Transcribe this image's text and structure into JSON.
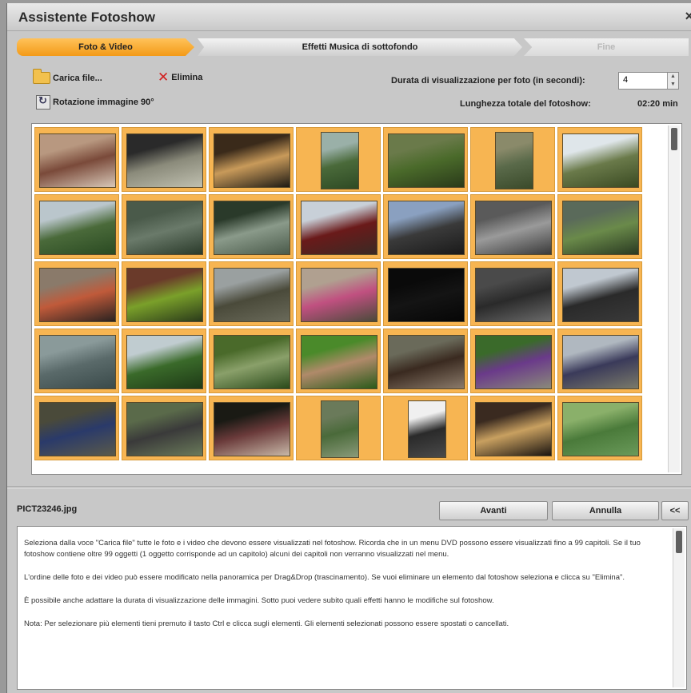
{
  "window": {
    "title": "Assistente Fotoshow",
    "close_glyph": "×"
  },
  "steps": [
    "Foto & Video",
    "Effetti  Musica di sottofondo",
    "Fine"
  ],
  "toolbar": {
    "load_label": "Carica file...",
    "delete_label": "Elimina",
    "rotate_label": "Rotazione immagine 90°",
    "duration_label": "Durata di visualizzazione per foto (in secondi):",
    "duration_value": "4",
    "total_label": "Lunghezza totale del fotoshow:",
    "total_value": "02:20 min"
  },
  "photos": [
    {
      "o": "land",
      "c": [
        "#b89880",
        "#7a4a3a",
        "#d8c8b8"
      ]
    },
    {
      "o": "land",
      "c": [
        "#2a2a2a",
        "#8a8a7a",
        "#c0c0b0"
      ]
    },
    {
      "o": "land",
      "c": [
        "#3a2a1a",
        "#c89a5a",
        "#1e1a14"
      ]
    },
    {
      "o": "port",
      "c": [
        "#9ab0a8",
        "#4a6a3a",
        "#2e4a24"
      ]
    },
    {
      "o": "land",
      "c": [
        "#6a7a4a",
        "#4a6a2a",
        "#2a3a1a"
      ]
    },
    {
      "o": "port",
      "c": [
        "#8a8a6a",
        "#5a6a4a",
        "#3a4a2a"
      ]
    },
    {
      "o": "land",
      "c": [
        "#dfe6ea",
        "#6a7a4a",
        "#3a4a22"
      ]
    },
    {
      "o": "land",
      "c": [
        "#bac6cc",
        "#4a6a3a",
        "#2a4a22"
      ]
    },
    {
      "o": "land",
      "c": [
        "#4a5a4a",
        "#6a7a6a",
        "#2a3a2a"
      ]
    },
    {
      "o": "land",
      "c": [
        "#2a3a2a",
        "#8a9a8a",
        "#4a5a4a"
      ]
    },
    {
      "o": "land",
      "c": [
        "#c8d0d8",
        "#6a1a1a",
        "#3a2a24"
      ]
    },
    {
      "o": "land",
      "c": [
        "#8aa0c0",
        "#3a3a3a",
        "#1a1a1a"
      ]
    },
    {
      "o": "land",
      "c": [
        "#5a5a5a",
        "#9a9a9a",
        "#3a3a3a"
      ]
    },
    {
      "o": "land",
      "c": [
        "#5a6a5a",
        "#6a8a4a",
        "#2a3a22"
      ]
    },
    {
      "o": "land",
      "c": [
        "#8a7a6a",
        "#c05a3a",
        "#2a2220"
      ]
    },
    {
      "o": "land",
      "c": [
        "#6a3a2a",
        "#7aa02a",
        "#2a3a1a"
      ]
    },
    {
      "o": "land",
      "c": [
        "#9aa0a0",
        "#4a4a3a",
        "#6a6a5a"
      ]
    },
    {
      "o": "land",
      "c": [
        "#b0a090",
        "#c05080",
        "#4a4a3a"
      ]
    },
    {
      "o": "land",
      "c": [
        "#0a0a0a",
        "#141414",
        "#060606"
      ]
    },
    {
      "o": "land",
      "c": [
        "#4a4a4a",
        "#2a2a2a",
        "#6a6a6a"
      ]
    },
    {
      "o": "land",
      "c": [
        "#c0c8d0",
        "#2a2a2a",
        "#3a3a3a"
      ]
    },
    {
      "o": "land",
      "c": [
        "#8a9a9a",
        "#5a6a6a",
        "#3a4a4a"
      ]
    },
    {
      "o": "land",
      "c": [
        "#c0ccd0",
        "#3a6a2a",
        "#1e3a16"
      ]
    },
    {
      "o": "land",
      "c": [
        "#4a6a2a",
        "#8aa06a",
        "#2a4a1a"
      ]
    },
    {
      "o": "land",
      "c": [
        "#4a8a2a",
        "#b08a6a",
        "#2a5a1a"
      ]
    },
    {
      "o": "land",
      "c": [
        "#6a6a5a",
        "#3a2a20",
        "#8a7a6a"
      ]
    },
    {
      "o": "land",
      "c": [
        "#3a6a2a",
        "#6a3a8a",
        "#8a8a7a"
      ]
    },
    {
      "o": "land",
      "c": [
        "#b0b8c0",
        "#3a3a5a",
        "#7a7a6a"
      ]
    },
    {
      "o": "land",
      "c": [
        "#4a4a3a",
        "#2a3a6a",
        "#5a5a4a"
      ]
    },
    {
      "o": "land",
      "c": [
        "#5a6a4a",
        "#3a3a3a",
        "#6a7a5a"
      ]
    },
    {
      "o": "land",
      "c": [
        "#1a1a14",
        "#6a3a3a",
        "#c8b8a8"
      ]
    },
    {
      "o": "port",
      "c": [
        "#6a7a5a",
        "#4a6a3a",
        "#8a9a7a"
      ]
    },
    {
      "o": "port",
      "c": [
        "#f0f0f0",
        "#2a2a2a",
        "#4a4a4a"
      ]
    },
    {
      "o": "land",
      "c": [
        "#3a2a20",
        "#c8a060",
        "#1a1410"
      ]
    },
    {
      "o": "land",
      "c": [
        "#8ab06a",
        "#4a7a3a",
        "#6a9a5a"
      ]
    }
  ],
  "selected_file": "PICT23246.jpg",
  "buttons": {
    "next": "Avanti",
    "cancel": "Annulla",
    "collapse": "<<"
  },
  "help_paragraphs": [
    "Seleziona dalla voce \"Carica file\" tutte le foto e i video che devono essere visualizzati nel fotoshow. Ricorda che in un menu DVD possono essere visualizzati fino a 99 capitoli. Se il tuo fotoshow contiene oltre 99 oggetti (1 oggetto corrisponde ad un capitolo) alcuni dei capitoli non verranno visualizzati nel menu.",
    "L'ordine delle foto e dei video può essere modificato nella panoramica per Drag&Drop (trascinamento). Se vuoi eliminare un elemento dal fotoshow seleziona e clicca su \"Elimina\".",
    "È possibile anche adattare la durata di visualizzazione delle immagini. Sotto puoi vedere subito quali effetti hanno le modifiche sul fotoshow.",
    "Nota: Per selezionare più elementi tieni premuto il tasto Ctrl e clicca sugli elementi. Gli elementi selezionati possono essere spostati o cancellati."
  ]
}
